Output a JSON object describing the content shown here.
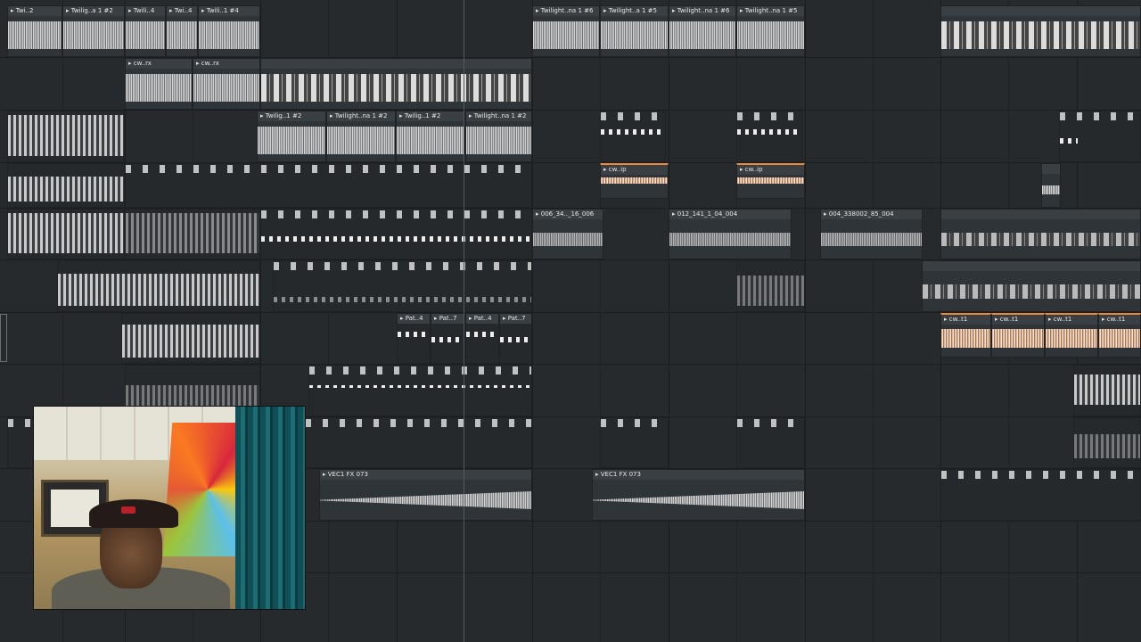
{
  "playlist": {
    "track1": {
      "clip1": "Twi..2",
      "clip2": "Twilig..a 1 #2",
      "clip3": "Twili..4",
      "clip4": "Twi..4",
      "clip5": "Twili..1 #4",
      "clip6": "Twilight..na 1 #6",
      "clip7": "Twilight..a 1 #5",
      "clip8": "Twilight..na 1 #6",
      "clip9": "Twilight..na 1 #5"
    },
    "track2": {
      "clip1": "cw..rx",
      "clip2": "cw..rx"
    },
    "track3": {
      "clip1": "Twilig..1 #2",
      "clip2": "Twilight..na 1 #2",
      "clip3": "Twilig..1 #2",
      "clip4": "Twilight..na 1 #2"
    },
    "track4": {
      "clip1": "cw..ip",
      "clip2": "cw..ip"
    },
    "track5": {
      "clip1": "006_34.._16_006",
      "clip2": "012_141_1_04_004",
      "clip3": "004_338002_85_004"
    },
    "track7": {
      "clip1": "Pat..4",
      "clip2": "Pat..7",
      "clip3": "Pat..4",
      "clip4": "Pat..7",
      "clip5": "cw..t1",
      "clip6": "cw..t1",
      "clip7": "cw..t1",
      "clip8": "cw..t1"
    },
    "track10": {
      "clip1": "VEC1 FX 073",
      "clip2": "VEC1 FX 073"
    }
  },
  "colors": {
    "background": "#262a2d",
    "clip_header": "#3a3f44",
    "waveform": "#d6d6d6",
    "selected_accent": "#e98b3b"
  },
  "icons": {
    "clip_play": "play-triangle-icon",
    "pattern": "pattern-icon"
  }
}
